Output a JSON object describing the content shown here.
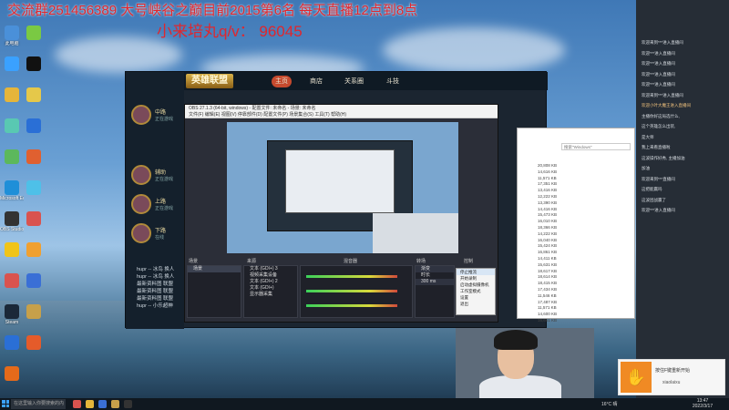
{
  "overlay": {
    "banner": "交流群251456389 大号峡谷之巅目前2015第6名 每天直播12点到8点",
    "sub_banner": "小来培丸q/v：  96045"
  },
  "desktop_icons": [
    {
      "label": "此电脑",
      "color": "#4a90d9"
    },
    {
      "label": "",
      "color": "#7ac943"
    },
    {
      "label": "",
      "color": "#3aa1ff"
    },
    {
      "label": "",
      "color": "#111111"
    },
    {
      "label": "",
      "color": "#e5b53a"
    },
    {
      "label": "",
      "color": "#e5c84a"
    },
    {
      "label": "",
      "color": "#59c8b2"
    },
    {
      "label": "",
      "color": "#2a6fd6"
    },
    {
      "label": "",
      "color": "#5cb85c"
    },
    {
      "label": "",
      "color": "#e06030"
    },
    {
      "label": "Microsoft Edge",
      "color": "#1f8fd8"
    },
    {
      "label": "",
      "color": "#4ec0e8"
    },
    {
      "label": "OBS Studio",
      "color": "#333333"
    },
    {
      "label": "",
      "color": "#d9534f"
    },
    {
      "label": "",
      "color": "#f0c419"
    },
    {
      "label": "",
      "color": "#f0a030"
    },
    {
      "label": "",
      "color": "#d9534f"
    },
    {
      "label": "",
      "color": "#3a6fd6"
    },
    {
      "label": "Steam",
      "color": "#1b2838"
    },
    {
      "label": "",
      "color": "#c7a04a"
    },
    {
      "label": "",
      "color": "#2a6fd6"
    },
    {
      "label": "",
      "color": "#e55b2a"
    },
    {
      "label": "",
      "color": "#e56a1a"
    }
  ],
  "lol": {
    "logo": "英雄联盟",
    "tabs": [
      "主页",
      "商店",
      "关系圈",
      "斗技"
    ],
    "friends": [
      {
        "name": "中路",
        "status": "正在游戏"
      },
      {
        "name": "辅助",
        "status": "正在游戏"
      },
      {
        "name": "上路",
        "status": "正在游戏"
      },
      {
        "name": "下路",
        "status": "在线"
      }
    ],
    "chat": [
      "hupr -- 冰鸟 换人",
      "hupr -- 冰鸟 换人",
      "最新资料图 联盟",
      "最新资料图 联盟",
      "最新资料图 联盟",
      "hupr -- 小乐超神"
    ]
  },
  "obs": {
    "title": "OBS 27.1.3 (64-bit, windows) - 配置文件: 未命名 - 场景: 未命名",
    "menu": "文件(F)  编辑(E)  视图(V)  停靠部件(D)  配置文件(P)  场景集合(S)  工具(T)  帮助(H)",
    "scenes_header": "场景",
    "sources_header": "来源",
    "mixer_header": "混音器",
    "transitions_header": "转场",
    "controls_header": "控制",
    "scenes": [
      "场景"
    ],
    "sources": [
      "文本 (GDI+) 3",
      "视频采集设备",
      "文本 (GDI+) 2",
      "文本 (GDI+)",
      "显示器采集"
    ],
    "transition_value": "渐变",
    "duration_label": "时长",
    "duration_value": "300 ms",
    "context_menu": [
      "停止推流",
      "开始录制",
      "启动虚拟摄像机",
      "工作室模式",
      "设置",
      "退出"
    ]
  },
  "explorer": {
    "search_placeholder": "搜索\"Windows\"",
    "sizes": [
      "20,808 KB",
      "14,616 KB",
      "11,571 KB",
      "17,351 KB",
      "13,416 KB",
      "12,222 KB",
      "13,390 KB",
      "14,416 KB",
      "15,473 KB",
      "16,010 KB",
      "18,366 KB",
      "14,222 KB",
      "16,040 KB",
      "15,424 KB",
      "16,861 KB",
      "14,411 KB",
      "15,631 KB",
      "18,617 KB",
      "18,614 KB",
      "18,415 KB",
      "17,434 KB",
      "11,546 KB",
      "17,487 KB",
      "11,571 KB",
      "14,600 KB",
      "16,661 KB"
    ]
  },
  "chat_panel": {
    "lines": [
      {
        "text": "欢迎来到***进入直播间",
        "hl": false
      },
      {
        "text": "欢迎***进入直播间",
        "hl": false
      },
      {
        "text": "欢迎***进入直播间",
        "hl": false
      },
      {
        "text": "欢迎***进入直播间",
        "hl": false
      },
      {
        "text": "欢迎***进入直播间",
        "hl": false
      },
      {
        "text": "欢迎来到***进入直播间",
        "hl": false
      },
      {
        "text": "欢迎小叶大魔王进入直播间",
        "hl": true
      },
      {
        "text": "主播你好这局选什么,",
        "hl": false
      },
      {
        "text": "这个英雄怎么出装,",
        "hl": false
      },
      {
        "text": "是大师",
        "hl": false
      },
      {
        "text": "我上来看直播啦",
        "hl": false
      },
      {
        "text": "这波操作好秀, 主播加油",
        "hl": false
      },
      {
        "text": "加油",
        "hl": false
      },
      {
        "text": "欢迎来到***直播间",
        "hl": false
      },
      {
        "text": "这把能赢吗",
        "hl": false
      },
      {
        "text": "这波团战赢了",
        "hl": false
      },
      {
        "text": "欢迎***进入直播间",
        "hl": false
      }
    ]
  },
  "notification": {
    "title": "按住F键重新开始",
    "user": "xiaolaixu"
  },
  "taskbar": {
    "search": "在这里输入你要搜索的内容",
    "weather": "16°C 晴",
    "time": "13:47",
    "date": "2022/3/17"
  }
}
